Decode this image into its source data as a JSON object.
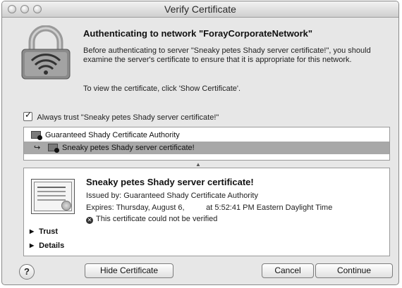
{
  "window": {
    "title": "Verify Certificate"
  },
  "header": {
    "title": "Authenticating to network \"ForayCorporateNetwork\"",
    "description": "Before authenticating to server \"Sneaky petes Shady server certificate!\", you should examine the server's certificate to ensure that it is appropriate for this network.",
    "hint": "To view the certificate, click 'Show Certificate'."
  },
  "always_trust": {
    "checked": true,
    "label": "Always trust \"Sneaky petes Shady server certificate!\""
  },
  "cert_chain": [
    {
      "label": "Guaranteed Shady Certificate Authority",
      "icon": "certificate-icon",
      "selected": false
    },
    {
      "label": "Sneaky petes Shady server certificate!",
      "icon": "certificate-icon",
      "selected": true
    }
  ],
  "detail": {
    "name": "Sneaky petes Shady server certificate!",
    "issued_by": "Issued by: Guaranteed Shady Certificate Authority",
    "expires": "Expires: Thursday, August 6,          at 5:52:41 PM Eastern Daylight Time",
    "status": "This certificate could not be verified",
    "sections": [
      "Trust",
      "Details"
    ]
  },
  "buttons": {
    "help": "?",
    "hide": "Hide Certificate",
    "cancel": "Cancel",
    "continue": "Continue"
  },
  "icons": {
    "lock": "lock-wifi-icon",
    "error": "error-x-icon"
  },
  "colors": {
    "window_bg": "#e7e7e7",
    "selection": "#a8a8a8"
  }
}
